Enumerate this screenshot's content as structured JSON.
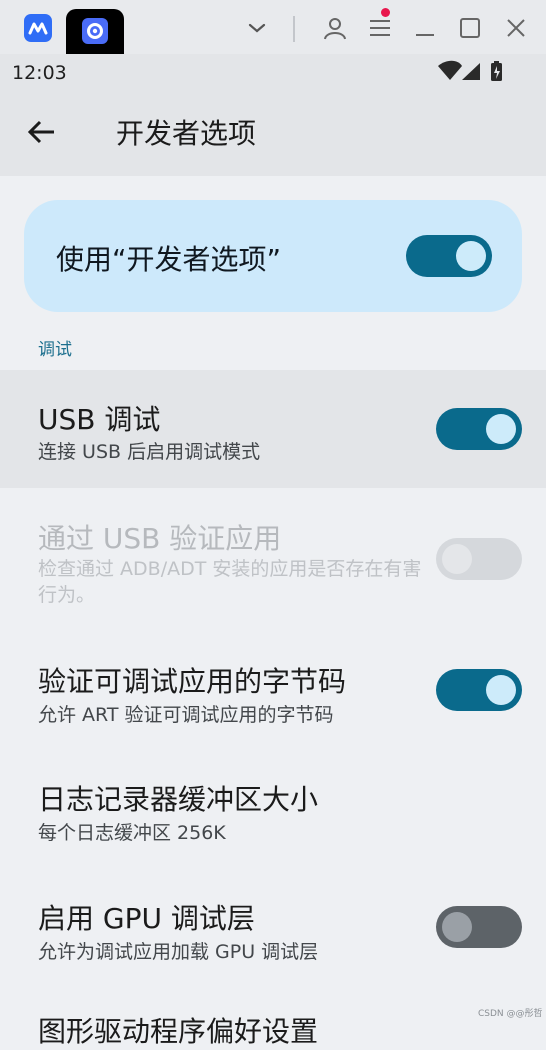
{
  "status_bar": {
    "time": "12:03"
  },
  "app_bar": {
    "title": "开发者选项"
  },
  "master_toggle": {
    "label": "使用“开发者选项”",
    "on": true
  },
  "section": {
    "header": "调试"
  },
  "settings": [
    {
      "title": "USB 调试",
      "subtitle": "连接 USB 后启用调试模式",
      "switch": "on"
    },
    {
      "title": "通过 USB 验证应用",
      "subtitle": "检查通过 ADB/ADT 安装的应用是否存在有害行为。",
      "switch": "off-disabled"
    },
    {
      "title": "验证可调试应用的字节码",
      "subtitle": "允许 ART 验证可调试应用的字节码",
      "switch": "on"
    },
    {
      "title": "日志记录器缓冲区大小",
      "subtitle": "每个日志缓冲区 256K"
    },
    {
      "title": "启用 GPU 调试层",
      "subtitle": "允许为调试应用加载 GPU 调试层",
      "switch": "off"
    },
    {
      "title": "图形驱动程序偏好设置",
      "subtitle": ""
    }
  ],
  "watermark": "CSDN @@彤哲",
  "colors": {
    "accent": "#0a6a8c",
    "card": "#cde9fb",
    "header": "#1c6f8e"
  }
}
